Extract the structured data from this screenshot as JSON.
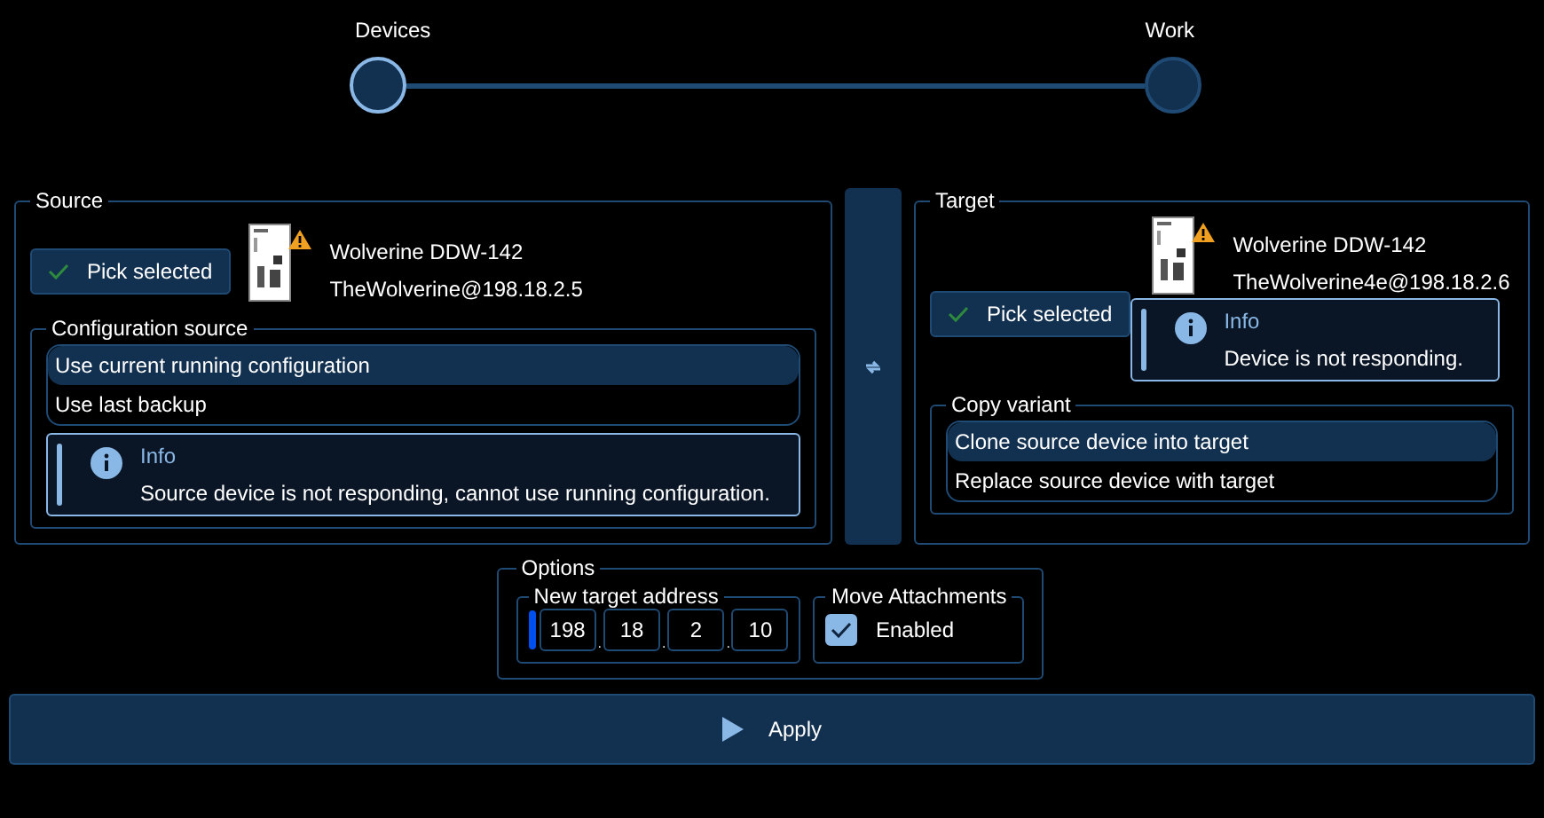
{
  "stepper": {
    "steps": [
      {
        "label": "Devices",
        "selected": true
      },
      {
        "label": "Work",
        "selected": false
      }
    ]
  },
  "source": {
    "title": "Source",
    "pick_button": "Pick selected",
    "device": {
      "name": "Wolverine DDW-142",
      "address": "TheWolverine@198.18.2.5",
      "warning": true
    },
    "config_source": {
      "title": "Configuration source",
      "options": [
        {
          "label": "Use current running configuration",
          "selected": true
        },
        {
          "label": "Use last backup",
          "selected": false
        }
      ]
    },
    "info": {
      "title": "Info",
      "text": "Source device is not responding, cannot use running configuration."
    }
  },
  "target": {
    "title": "Target",
    "pick_button": "Pick selected",
    "device": {
      "name": "Wolverine DDW-142",
      "address": "TheWolverine4e@198.18.2.6",
      "warning": true
    },
    "info": {
      "title": "Info",
      "text": "Device is not responding."
    },
    "copy_variant": {
      "title": "Copy variant",
      "options": [
        {
          "label": "Clone source device into target",
          "selected": true
        },
        {
          "label": "Replace source device with target",
          "selected": false
        }
      ]
    }
  },
  "options": {
    "title": "Options",
    "address": {
      "title": "New target address",
      "separator": ".",
      "octets": [
        "198",
        "18",
        "2",
        "10"
      ]
    },
    "move_attachments": {
      "title": "Move Attachments",
      "label": "Enabled",
      "checked": true
    }
  },
  "apply_button": "Apply"
}
